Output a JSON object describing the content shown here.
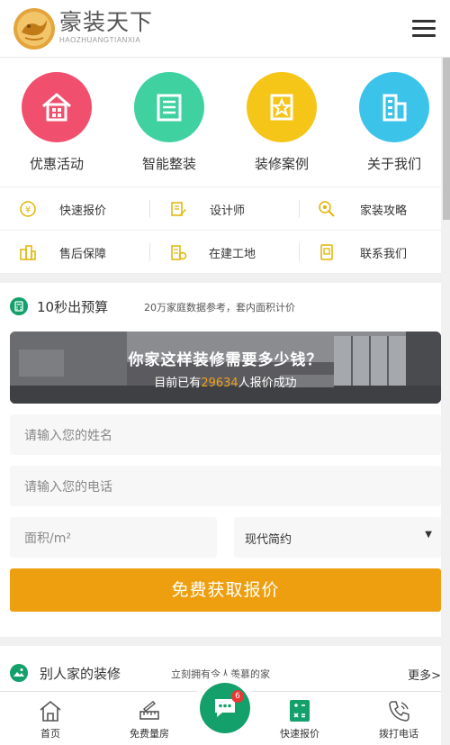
{
  "header": {
    "brand_name": "豪装天下",
    "brand_sub": "HAOZHUANGTIANXIA"
  },
  "nav": [
    {
      "label": "优惠活动",
      "icon": "house-icon",
      "color": "#f0506e"
    },
    {
      "label": "智能整装",
      "icon": "document-icon",
      "color": "#3fd1a0"
    },
    {
      "label": "装修案例",
      "icon": "star-frame-icon",
      "color": "#f5c518"
    },
    {
      "label": "关于我们",
      "icon": "building-icon",
      "color": "#3cc3ea"
    }
  ],
  "links": [
    {
      "label": "快速报价",
      "icon": "yen-icon"
    },
    {
      "label": "设计师",
      "icon": "pencil-note-icon"
    },
    {
      "label": "家装攻略",
      "icon": "magnifier-icon"
    },
    {
      "label": "售后保障",
      "icon": "buildings-icon"
    },
    {
      "label": "在建工地",
      "icon": "site-icon"
    },
    {
      "label": "联系我们",
      "icon": "phone-card-icon"
    }
  ],
  "budget": {
    "title": "10秒出预算",
    "subtitle": "20万家庭数据参考，套内面积计价",
    "banner_title": "你家这样装修需要多少钱？",
    "banner_prefix": "目前已有",
    "banner_count": "29634",
    "banner_suffix": "人报价成功",
    "name_placeholder": "请输入您的姓名",
    "phone_placeholder": "请输入您的电话",
    "area_placeholder": "面积/m²",
    "style_selected": "现代简约",
    "submit_label": "免费获取报价"
  },
  "others": {
    "title": "别人家的装修",
    "subtitle": "立刻拥有令人羡慕的家",
    "more": "更多>"
  },
  "tabbar": {
    "home": "首页",
    "measure": "免费量房",
    "chat_badge": "6",
    "quote": "快速报价",
    "call": "拨打电话"
  },
  "colors": {
    "accent": "#ee9f10",
    "green": "#14a06a"
  }
}
